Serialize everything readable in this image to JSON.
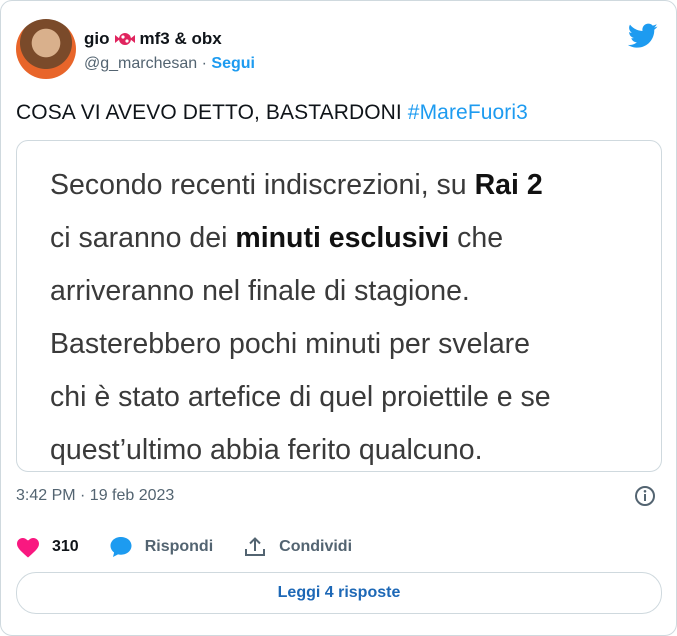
{
  "author": {
    "display_name": "gio",
    "display_name_suffix": "mf3 & obx",
    "handle": "@g_marchesan",
    "separator": "·",
    "follow_label": "Segui"
  },
  "tweet": {
    "text": "COSA VI AVEVO DETTO, BASTARDONI ",
    "hashtag": "#MareFuori3",
    "timestamp": "3:42 PM · 19 feb 2023"
  },
  "media": {
    "lines": [
      {
        "pre": "Secondo recenti indiscrezioni, su ",
        "bold": "Rai 2",
        "post": ""
      },
      {
        "pre": "ci saranno dei ",
        "bold": "minuti esclusivi",
        "post": " che"
      },
      {
        "pre": "arriveranno nel finale di stagione.",
        "bold": "",
        "post": ""
      },
      {
        "pre": "Basterebbero pochi minuti per svelare",
        "bold": "",
        "post": ""
      },
      {
        "pre": "chi è stato artefice di quel proiettile e se",
        "bold": "",
        "post": ""
      },
      {
        "pre": "quest’ultimo abbia ferito qualcuno.",
        "bold": "",
        "post": ""
      }
    ]
  },
  "actions": {
    "likes_count": "310",
    "reply_label": "Rispondi",
    "share_label": "Condividi"
  },
  "replies_button": {
    "label": "Leggi 4 risposte"
  },
  "colors": {
    "accent": "#1d9bf0",
    "like": "#f91880",
    "muted": "#536471",
    "border": "#cfd9de"
  },
  "icons": [
    "candy-icon",
    "twitter-bird-icon",
    "info-icon",
    "heart-icon",
    "reply-bubble-icon",
    "share-icon"
  ]
}
